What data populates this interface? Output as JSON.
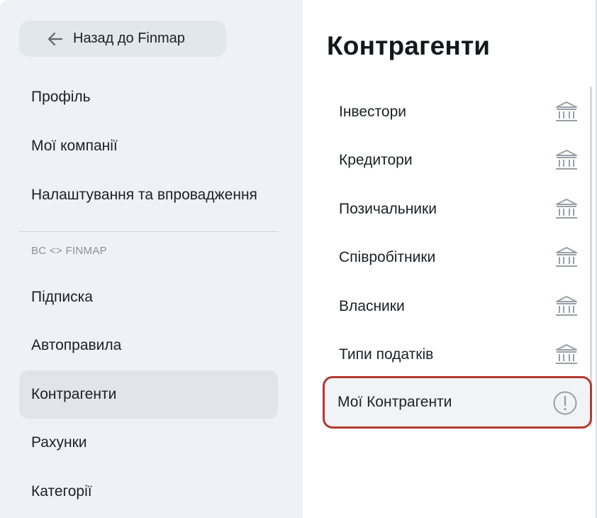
{
  "sidebar": {
    "back_label": "Назад до Finmap",
    "items_top": [
      {
        "label": "Профіль"
      },
      {
        "label": "Мої компанії"
      },
      {
        "label": "Налаштування та впровадження"
      }
    ],
    "section_label": "BC <> FINMAP",
    "items_bottom": [
      {
        "label": "Підписка"
      },
      {
        "label": "Автоправила"
      },
      {
        "label": "Контрагенти",
        "active": true
      },
      {
        "label": "Рахунки"
      },
      {
        "label": "Категорії"
      }
    ]
  },
  "main": {
    "title": "Контрагенти",
    "items": [
      {
        "label": "Інвестори",
        "icon": "bank-icon"
      },
      {
        "label": "Кредитори",
        "icon": "bank-icon"
      },
      {
        "label": "Позичальники",
        "icon": "bank-icon"
      },
      {
        "label": "Співробітники",
        "icon": "bank-icon"
      },
      {
        "label": "Власники",
        "icon": "bank-icon"
      },
      {
        "label": "Типи податків",
        "icon": "bank-icon"
      },
      {
        "label": "Мої Контрагенти",
        "icon": "alert-circle-icon",
        "highlighted": true
      }
    ]
  },
  "colors": {
    "sidebar_bg": "#eef2f6",
    "active_item_bg": "#e1e4e8",
    "highlight_border": "#b23b30",
    "icon_gray": "#9a9ea5"
  }
}
